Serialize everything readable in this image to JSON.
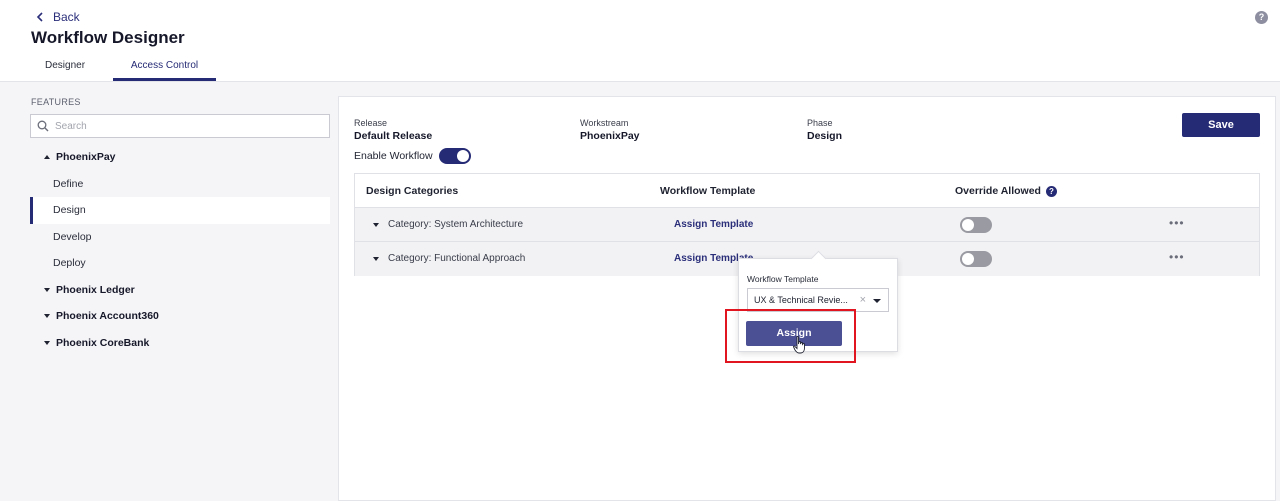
{
  "header": {
    "back_label": "Back",
    "title": "Workflow Designer",
    "tabs": [
      {
        "label": "Designer",
        "active": false
      },
      {
        "label": "Access Control",
        "active": true
      }
    ],
    "help_icon": "?"
  },
  "sidebar": {
    "section_label": "FEATURES",
    "search_placeholder": "Search",
    "tree": [
      {
        "label": "PhoenixPay",
        "expanded": true,
        "children": [
          "Define",
          "Design",
          "Develop",
          "Deploy"
        ],
        "selected_child": "Design"
      },
      {
        "label": "Phoenix Ledger",
        "expanded": false
      },
      {
        "label": "Phoenix Account360",
        "expanded": false
      },
      {
        "label": "Phoenix CoreBank",
        "expanded": false
      }
    ]
  },
  "main": {
    "release": {
      "label": "Release",
      "value": "Default Release"
    },
    "workstream": {
      "label": "Workstream",
      "value": "PhoenixPay"
    },
    "phase": {
      "label": "Phase",
      "value": "Design"
    },
    "save_label": "Save",
    "enable_workflow": {
      "label": "Enable Workflow",
      "on": true
    },
    "table": {
      "columns": [
        "Design Categories",
        "Workflow Template",
        "Override Allowed"
      ],
      "rows": [
        {
          "category": "Category: System Architecture",
          "template_link": "Assign Template",
          "override": false
        },
        {
          "category": "Category: Functional Approach",
          "template_link": "Assign Template",
          "override": false
        }
      ]
    },
    "popover": {
      "label": "Workflow Template",
      "selected_value": "UX & Technical Revie...",
      "clear_icon": "×",
      "assign_label": "Assign"
    }
  },
  "colors": {
    "primary": "#262b75",
    "assign_button": "#4b4f94",
    "highlight": "#e0151f"
  }
}
